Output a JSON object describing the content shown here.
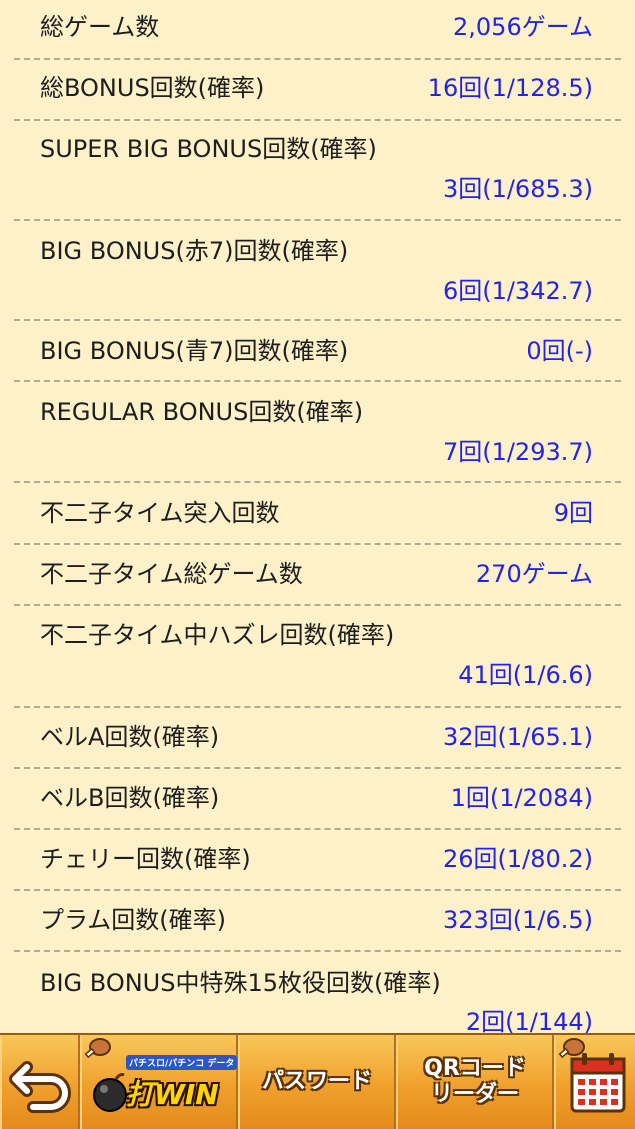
{
  "stats": [
    {
      "label": "総ゲーム数",
      "value": "2,056ゲーム"
    },
    {
      "label": "総BONUS回数(確率)",
      "value": "16回(1/128.5)"
    },
    {
      "label": "SUPER BIG BONUS回数(確率)",
      "value": "3回(1/685.3)"
    },
    {
      "label": "BIG BONUS(赤7)回数(確率)",
      "value": "6回(1/342.7)"
    },
    {
      "label": "BIG BONUS(青7)回数(確率)",
      "value": "0回(-)"
    },
    {
      "label": "REGULAR BONUS回数(確率)",
      "value": "7回(1/293.7)"
    },
    {
      "label": "不二子タイム突入回数",
      "value": "9回"
    },
    {
      "label": "不二子タイム総ゲーム数",
      "value": "270ゲーム"
    },
    {
      "label": "不二子タイム中ハズレ回数(確率)",
      "value": "41回(1/6.6)"
    },
    {
      "label": "ベルA回数(確率)",
      "value": "32回(1/65.1)"
    },
    {
      "label": "ベルB回数(確率)",
      "value": "1回(1/2084)"
    },
    {
      "label": "チェリー回数(確率)",
      "value": "26回(1/80.2)"
    },
    {
      "label": "プラム回数(確率)",
      "value": "323回(1/6.5)"
    },
    {
      "label": "BIG BONUS中特殊15枚役回数(確率)",
      "value": "2回(1/144)"
    }
  ],
  "toolbar": {
    "back_icon": "back-arrow-icon",
    "logo_main": "打WIN",
    "logo_sub": "パチスロ/パチンコ データ",
    "password_label": "パスワード",
    "qr_label": "QRコード\nリーダー",
    "calendar_icon": "calendar-icon",
    "colors": {
      "bar": "#f2a52a",
      "text_outline": "#5a3209"
    }
  },
  "colors": {
    "background": "#fdf1c9",
    "label": "#1e1e1e",
    "value": "#2323e8",
    "separator": "#b3aa90"
  }
}
